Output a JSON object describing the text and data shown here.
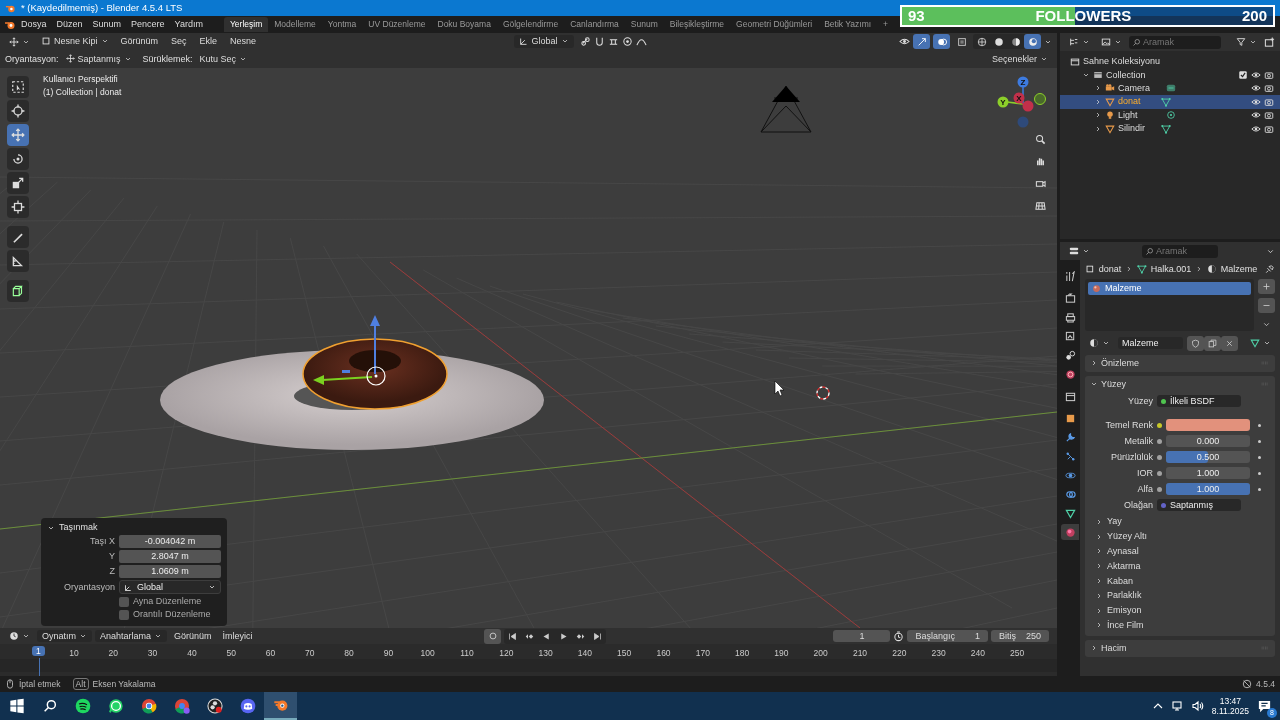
{
  "window": {
    "title": "* (Kaydedilmemiş) - Blender 4.5.4 LTS"
  },
  "followers_goal": {
    "current": "93",
    "label": "FOLLOWERS",
    "goal": "200",
    "level": 0.465
  },
  "menubar": [
    "Dosya",
    "Düzen",
    "Sunum",
    "Pencere",
    "Yardım"
  ],
  "workspaces": [
    {
      "label": "Yerleşim",
      "selected": true
    },
    {
      "label": "Modelleme",
      "selected": false
    },
    {
      "label": "Yontma",
      "selected": false
    },
    {
      "label": "UV Düzenleme",
      "selected": false
    },
    {
      "label": "Doku Boyama",
      "selected": false
    },
    {
      "label": "Gölgelendirme",
      "selected": false
    },
    {
      "label": "Canlandırma",
      "selected": false
    },
    {
      "label": "Sunum",
      "selected": false
    },
    {
      "label": "Bileşikleştirme",
      "selected": false
    },
    {
      "label": "Geometri Düğümleri",
      "selected": false
    },
    {
      "label": "Betik Yazımı",
      "selected": false
    }
  ],
  "add_workspace": "+",
  "viewport": {
    "header": {
      "mode": "Nesne Kipi",
      "menus": [
        "Görünüm",
        "Seç",
        "Ekle",
        "Nesne"
      ],
      "orientation": "Global",
      "toggles": [
        {
          "kind": "gizmos",
          "on": true
        },
        {
          "kind": "overlays",
          "on": true
        },
        {
          "kind": "xray",
          "on": false
        }
      ],
      "shading": [
        {
          "kind": "wireframe",
          "selected": false
        },
        {
          "kind": "solid",
          "selected": false
        },
        {
          "kind": "material",
          "selected": false
        },
        {
          "kind": "rendered",
          "selected": true
        }
      ]
    },
    "tool_settings": {
      "orientation_label": "Oryantasyon:",
      "orientation": "Saptanmış",
      "drag_label": "Sürüklemek:",
      "drag": "Kutu Seç",
      "options": "Seçenekler"
    },
    "info": [
      "Kullanıcı Perspektifi",
      "(1) Collection | donat"
    ],
    "tools": [
      {
        "kind": "select",
        "selected": false
      },
      {
        "kind": "cursor",
        "selected": false
      },
      {
        "kind": "move",
        "selected": true
      },
      {
        "kind": "rotate",
        "selected": false
      },
      {
        "kind": "scale",
        "selected": false
      },
      {
        "kind": "transform",
        "selected": false
      },
      {
        "kind": "annotate",
        "selected": false
      },
      {
        "kind": "measure",
        "selected": false
      },
      {
        "kind": "add-cube",
        "selected": false
      }
    ],
    "axes": [
      "Z",
      "Y",
      "X"
    ],
    "operator_panel": {
      "title": "Taşınmak",
      "expanded": true,
      "fields": [
        {
          "label": "Taşı X",
          "value": "-0.004042 m"
        },
        {
          "label": "Y",
          "value": "2.8047 m"
        },
        {
          "label": "Z",
          "value": "1.0609 m"
        }
      ],
      "orientation_label": "Oryantasyon",
      "orientation": "Global",
      "checkboxes": [
        {
          "label": "Ayna Düzenleme",
          "checked": false
        },
        {
          "label": "Orantılı Düzenleme",
          "checked": false
        }
      ]
    }
  },
  "timeline": {
    "menus": [
      {
        "label": "Oynatım",
        "kind": "dropdown"
      },
      {
        "label": "Anahtarlama",
        "kind": "dropdown"
      },
      {
        "label": "Görünüm",
        "kind": "menu"
      },
      {
        "label": "İmleyici",
        "kind": "menu"
      }
    ],
    "current_frame": "1",
    "start_label": "Başlangıç",
    "start": "1",
    "end_label": "Bitiş",
    "end": "250",
    "playhead": "1",
    "ruler": [
      "10",
      "20",
      "30",
      "40",
      "50",
      "60",
      "70",
      "80",
      "90",
      "100",
      "110",
      "120",
      "130",
      "140",
      "150",
      "160",
      "170",
      "180",
      "190",
      "200",
      "210",
      "220",
      "230",
      "240",
      "250"
    ]
  },
  "outliner": {
    "search_placeholder": "Aramak",
    "tree": [
      {
        "label": "Sahne Koleksiyonu",
        "kind": "scene",
        "selected": false,
        "children": [
          {
            "label": "Collection",
            "kind": "collection",
            "selected": false,
            "expanded": true,
            "checked": true,
            "children": [
              {
                "label": "Camera",
                "kind": "camera",
                "selected": false,
                "expanded": false
              },
              {
                "label": "donat",
                "kind": "mesh",
                "selected": true,
                "expanded": false
              },
              {
                "label": "Light",
                "kind": "light",
                "selected": false,
                "expanded": false
              },
              {
                "label": "Silindir",
                "kind": "mesh",
                "selected": false,
                "expanded": false
              }
            ]
          }
        ]
      }
    ]
  },
  "properties": {
    "search_placeholder": "Aramak",
    "breadcrumb": [
      "donat",
      "Halka.001",
      "Malzeme"
    ],
    "tabs": [
      {
        "kind": "tool",
        "selected": false
      },
      {
        "kind": "render",
        "selected": false
      },
      {
        "kind": "output",
        "selected": false
      },
      {
        "kind": "view-layer",
        "selected": false
      },
      {
        "kind": "scene",
        "selected": false
      },
      {
        "kind": "world",
        "selected": false
      },
      {
        "kind": "collection",
        "selected": false
      },
      {
        "kind": "object",
        "selected": false
      },
      {
        "kind": "modifier",
        "selected": false
      },
      {
        "kind": "particles",
        "selected": false
      },
      {
        "kind": "physics",
        "selected": false
      },
      {
        "kind": "constraints",
        "selected": false
      },
      {
        "kind": "data",
        "selected": false
      },
      {
        "kind": "material",
        "selected": true
      }
    ],
    "material_slots": [
      {
        "name": "Malzeme",
        "selected": true
      }
    ],
    "material_name": "Malzeme",
    "panels": [
      {
        "title": "Önizleme",
        "expanded": false
      },
      {
        "title": "Yüzey",
        "expanded": true,
        "fields": [
          {
            "kind": "shader",
            "label": "Yüzey",
            "value": "İlkeli BSDF"
          },
          {
            "kind": "swatch",
            "label": "Temel Renk",
            "color": "#e2917c"
          },
          {
            "kind": "number",
            "label": "Metalik",
            "value": "0.000"
          },
          {
            "kind": "slider",
            "label": "Pürüzlülük",
            "value": "0.500",
            "level": 0.5
          },
          {
            "kind": "number",
            "label": "IOR",
            "value": "1.000"
          },
          {
            "kind": "slider",
            "label": "Alfa",
            "value": "1.000",
            "level": 1
          },
          {
            "kind": "vector",
            "label": "Olağan",
            "value": "Saptanmış"
          }
        ],
        "subpanels": [
          {
            "title": "Yay",
            "expanded": false
          },
          {
            "title": "Yüzey Altı",
            "expanded": false
          },
          {
            "title": "Aynasal",
            "expanded": false
          },
          {
            "title": "Aktarma",
            "expanded": false
          },
          {
            "title": "Kaban",
            "expanded": false
          },
          {
            "title": "Parlaklık",
            "expanded": false
          },
          {
            "title": "Emisyon",
            "expanded": false
          },
          {
            "title": "İnce Film",
            "expanded": false
          }
        ]
      },
      {
        "title": "Hacim",
        "expanded": false
      }
    ]
  },
  "status_bar": {
    "hints": [
      {
        "kind": "mouse",
        "text": "İptal etmek"
      },
      {
        "kind": "key",
        "key": "Alt",
        "text": "Eksen Yakalama"
      }
    ],
    "version": "4.5.4"
  },
  "taskbar": {
    "apps": [
      {
        "kind": "start",
        "active": false
      },
      {
        "kind": "search",
        "active": false
      },
      {
        "kind": "music",
        "active": false
      },
      {
        "kind": "chat",
        "active": false
      },
      {
        "kind": "browser",
        "active": false
      },
      {
        "kind": "browser-profile",
        "active": false
      },
      {
        "kind": "recorder",
        "active": false
      },
      {
        "kind": "voice-chat",
        "active": false
      },
      {
        "kind": "modeler",
        "active": true
      }
    ],
    "time": "13:47",
    "date": "8.11.2025",
    "notifications": "8"
  }
}
